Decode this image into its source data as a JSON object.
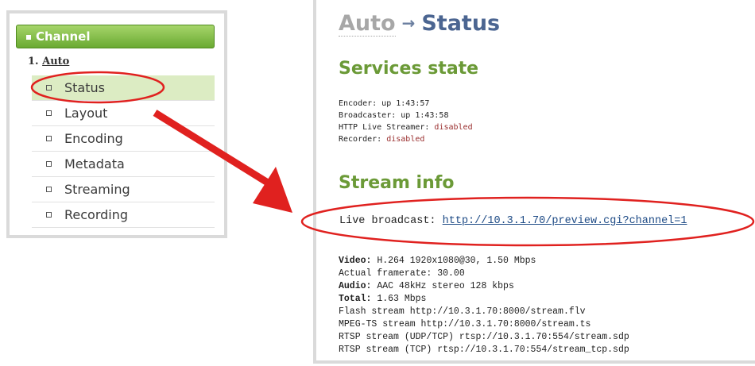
{
  "sidebar": {
    "header": "Channel",
    "channel_number": "1.",
    "channel_name": "Auto",
    "items": [
      {
        "label": "Status",
        "active": true
      },
      {
        "label": "Layout"
      },
      {
        "label": "Encoding"
      },
      {
        "label": "Metadata"
      },
      {
        "label": "Streaming"
      },
      {
        "label": "Recording"
      }
    ]
  },
  "main": {
    "breadcrumb_parent": "Auto",
    "breadcrumb_arrow": "→",
    "title": "Status",
    "services": {
      "heading": "Services state",
      "encoder": "Encoder: up 1:43:57",
      "broadcaster": "Broadcaster: up 1:43:58",
      "hls_label": "HTTP Live Streamer:",
      "hls_value": "disabled",
      "recorder_label": "Recorder:",
      "recorder_value": "disabled"
    },
    "stream": {
      "heading": "Stream info",
      "live_label": "Live broadcast:",
      "live_url": "http://10.3.1.70/preview.cgi?channel=1",
      "video_label": "Video:",
      "video_value": "H.264 1920x1080@30, 1.50 Mbps",
      "framerate": "Actual framerate: 30.00",
      "audio_label": "Audio:",
      "audio_value": "AAC 48kHz stereo 128 kbps",
      "total_label": "Total:",
      "total_value": "1.63 Mbps",
      "flash": "Flash stream http://10.3.1.70:8000/stream.flv",
      "mpegts": "MPEG-TS stream http://10.3.1.70:8000/stream.ts",
      "rtsp_udp": "RTSP stream (UDP/TCP) rtsp://10.3.1.70:554/stream.sdp",
      "rtsp_tcp": "RTSP stream (TCP) rtsp://10.3.1.70:554/stream_tcp.sdp"
    }
  },
  "annotation_color": "#e0211f"
}
